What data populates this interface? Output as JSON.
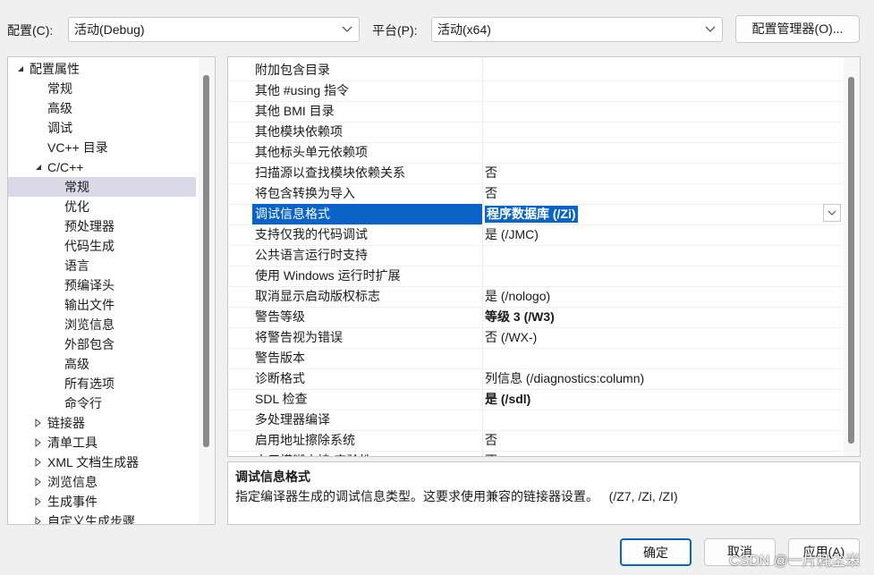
{
  "toolbar": {
    "config_label": "配置(C):",
    "config_value": "活动(Debug)",
    "platform_label": "平台(P):",
    "platform_value": "活动(x64)",
    "config_manager_button": "配置管理器(O)..."
  },
  "tree": {
    "items": [
      {
        "label": "配置属性",
        "level": 0,
        "expander": "expanded"
      },
      {
        "label": "常规",
        "level": 1,
        "expander": "none"
      },
      {
        "label": "高级",
        "level": 1,
        "expander": "none"
      },
      {
        "label": "调试",
        "level": 1,
        "expander": "none"
      },
      {
        "label": "VC++ 目录",
        "level": 1,
        "expander": "none"
      },
      {
        "label": "C/C++",
        "level": 1,
        "expander": "expanded"
      },
      {
        "label": "常规",
        "level": 2,
        "expander": "none",
        "selected": true
      },
      {
        "label": "优化",
        "level": 2,
        "expander": "none"
      },
      {
        "label": "预处理器",
        "level": 2,
        "expander": "none"
      },
      {
        "label": "代码生成",
        "level": 2,
        "expander": "none"
      },
      {
        "label": "语言",
        "level": 2,
        "expander": "none"
      },
      {
        "label": "预编译头",
        "level": 2,
        "expander": "none"
      },
      {
        "label": "输出文件",
        "level": 2,
        "expander": "none"
      },
      {
        "label": "浏览信息",
        "level": 2,
        "expander": "none"
      },
      {
        "label": "外部包含",
        "level": 2,
        "expander": "none"
      },
      {
        "label": "高级",
        "level": 2,
        "expander": "none"
      },
      {
        "label": "所有选项",
        "level": 2,
        "expander": "none"
      },
      {
        "label": "命令行",
        "level": 2,
        "expander": "none"
      },
      {
        "label": "链接器",
        "level": 1,
        "expander": "collapsed"
      },
      {
        "label": "清单工具",
        "level": 1,
        "expander": "collapsed"
      },
      {
        "label": "XML 文档生成器",
        "level": 1,
        "expander": "collapsed"
      },
      {
        "label": "浏览信息",
        "level": 1,
        "expander": "collapsed"
      },
      {
        "label": "生成事件",
        "level": 1,
        "expander": "collapsed"
      },
      {
        "label": "自定义生成步骤",
        "level": 1,
        "expander": "collapsed"
      }
    ]
  },
  "grid": {
    "rows": [
      {
        "name": "附加包含目录",
        "value": ""
      },
      {
        "name": "其他 #using 指令",
        "value": ""
      },
      {
        "name": "其他 BMI 目录",
        "value": ""
      },
      {
        "name": "其他模块依赖项",
        "value": ""
      },
      {
        "name": "其他标头单元依赖项",
        "value": ""
      },
      {
        "name": "扫描源以查找模块依赖关系",
        "value": "否"
      },
      {
        "name": "将包含转换为导入",
        "value": "否"
      },
      {
        "name": "调试信息格式",
        "value": "程序数据库 (/Zi)",
        "selected": true
      },
      {
        "name": "支持仅我的代码调试",
        "value": "是 (/JMC)"
      },
      {
        "name": "公共语言运行时支持",
        "value": ""
      },
      {
        "name": "使用 Windows 运行时扩展",
        "value": ""
      },
      {
        "name": "取消显示启动版权标志",
        "value": "是 (/nologo)"
      },
      {
        "name": "警告等级",
        "value": "等级 3 (/W3)",
        "bold": true
      },
      {
        "name": "将警告视为错误",
        "value": "否 (/WX-)"
      },
      {
        "name": "警告版本",
        "value": ""
      },
      {
        "name": "诊断格式",
        "value": "列信息 (/diagnostics:column)"
      },
      {
        "name": "SDL 检查",
        "value": "是 (/sdl)",
        "bold": true
      },
      {
        "name": "多处理器编译",
        "value": ""
      },
      {
        "name": "启用地址擦除系统",
        "value": "否"
      },
      {
        "name": "启用模糊支持(实验性)",
        "value": "否"
      }
    ]
  },
  "description": {
    "title": "调试信息格式",
    "text": "指定编译器生成的调试信息类型。这要求使用兼容的链接器设置。   (/Z7, /Zi, /ZI)"
  },
  "buttons": {
    "ok": "确定",
    "cancel": "取消",
    "apply": "应用(A)"
  },
  "watermark": "CSDN @一片耗尘米"
}
